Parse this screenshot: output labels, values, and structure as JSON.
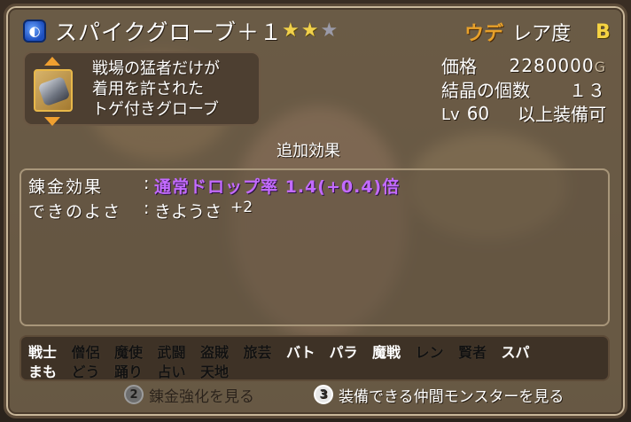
{
  "item": {
    "type_icon_name": "accessory-blue-icon",
    "name": "スパイクグローブ＋１",
    "stars_filled": 2,
    "stars_total": 3,
    "slot_type": "ウデ",
    "rarity_label": "レア度",
    "rarity_grade": "B",
    "description": [
      "戦場の猛者だけが",
      "着用を許された",
      "トゲ付きグローブ"
    ]
  },
  "stats": {
    "price_label": "価格",
    "price_value": "2280000",
    "price_unit": "G",
    "crystal_label": "結晶の個数",
    "crystal_value": "１３",
    "lv_label": "Lv",
    "lv_value": "60",
    "lv_suffix": "以上装備可"
  },
  "additional": {
    "header": "追加効果",
    "rows": [
      {
        "key": "錬金効果",
        "value": "通常ドロップ率 1.4(+0.4)倍",
        "style": "purple"
      },
      {
        "key": "できのよさ",
        "value": "きようさ",
        "bonus": "+2",
        "style": "normal"
      }
    ]
  },
  "jobs": {
    "row1": [
      {
        "label": "戦士",
        "equippable": true
      },
      {
        "label": "僧侶",
        "equippable": false
      },
      {
        "label": "魔使",
        "equippable": false
      },
      {
        "label": "武闘",
        "equippable": false
      },
      {
        "label": "盗賊",
        "equippable": false
      },
      {
        "label": "旅芸",
        "equippable": false
      },
      {
        "label": "バト",
        "equippable": true
      },
      {
        "label": "パラ",
        "equippable": true
      },
      {
        "label": "魔戦",
        "equippable": true
      },
      {
        "label": "レン",
        "equippable": false
      },
      {
        "label": "賢者",
        "equippable": false
      },
      {
        "label": "スパ",
        "equippable": true
      }
    ],
    "row2": [
      {
        "label": "まも",
        "equippable": true
      },
      {
        "label": "どう",
        "equippable": false
      },
      {
        "label": "踊り",
        "equippable": false
      },
      {
        "label": "占い",
        "equippable": false
      },
      {
        "label": "天地",
        "equippable": false
      }
    ]
  },
  "footer": {
    "btn2_num": "2",
    "btn2_label": "錬金強化を見る",
    "btn3_num": "3",
    "btn3_label": "装備できる仲間モンスターを見る"
  },
  "colors": {
    "purple_effect": "#c36bff",
    "star": "#f1d14a",
    "slot": "#e8a12a",
    "grade": "#f5d342"
  }
}
